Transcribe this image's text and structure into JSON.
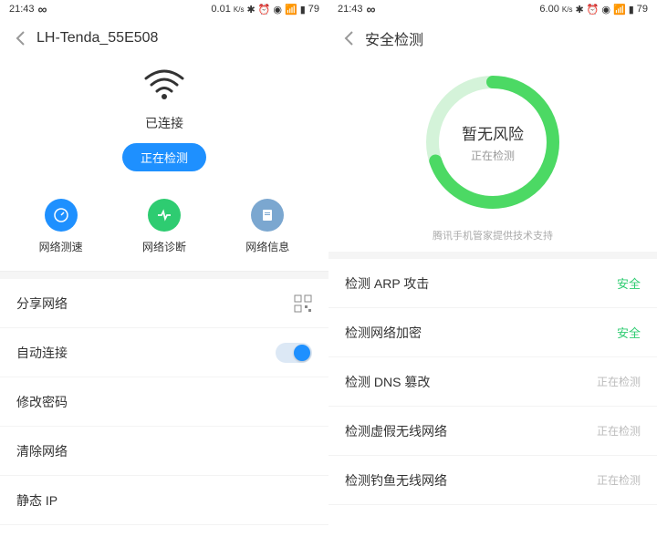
{
  "left": {
    "statusbar": {
      "time": "21:43",
      "speed": "0.01",
      "unit": "K/s",
      "battery": "79"
    },
    "header": {
      "title": "LH-Tenda_55E508"
    },
    "wifi": {
      "status": "已连接",
      "button": "正在检测"
    },
    "actions": [
      {
        "label": "网络测速"
      },
      {
        "label": "网络诊断"
      },
      {
        "label": "网络信息"
      }
    ],
    "menu": {
      "share": "分享网络",
      "auto": "自动连接",
      "password": "修改密码",
      "clear": "清除网络",
      "static_ip": "静态 IP"
    }
  },
  "right": {
    "statusbar": {
      "time": "21:43",
      "speed": "6.00",
      "unit": "K/s",
      "battery": "79"
    },
    "header": {
      "title": "安全检测"
    },
    "ring": {
      "title": "暂无风险",
      "sub": "正在检测"
    },
    "support": "腾讯手机管家提供技术支持",
    "checks": [
      {
        "label": "检测 ARP 攻击",
        "status": "安全",
        "safe": true
      },
      {
        "label": "检测网络加密",
        "status": "安全",
        "safe": true
      },
      {
        "label": "检测 DNS 篡改",
        "status": "正在检测",
        "safe": false
      },
      {
        "label": "检测虚假无线网络",
        "status": "正在检测",
        "safe": false
      },
      {
        "label": "检测钓鱼无线网络",
        "status": "正在检测",
        "safe": false
      }
    ]
  }
}
